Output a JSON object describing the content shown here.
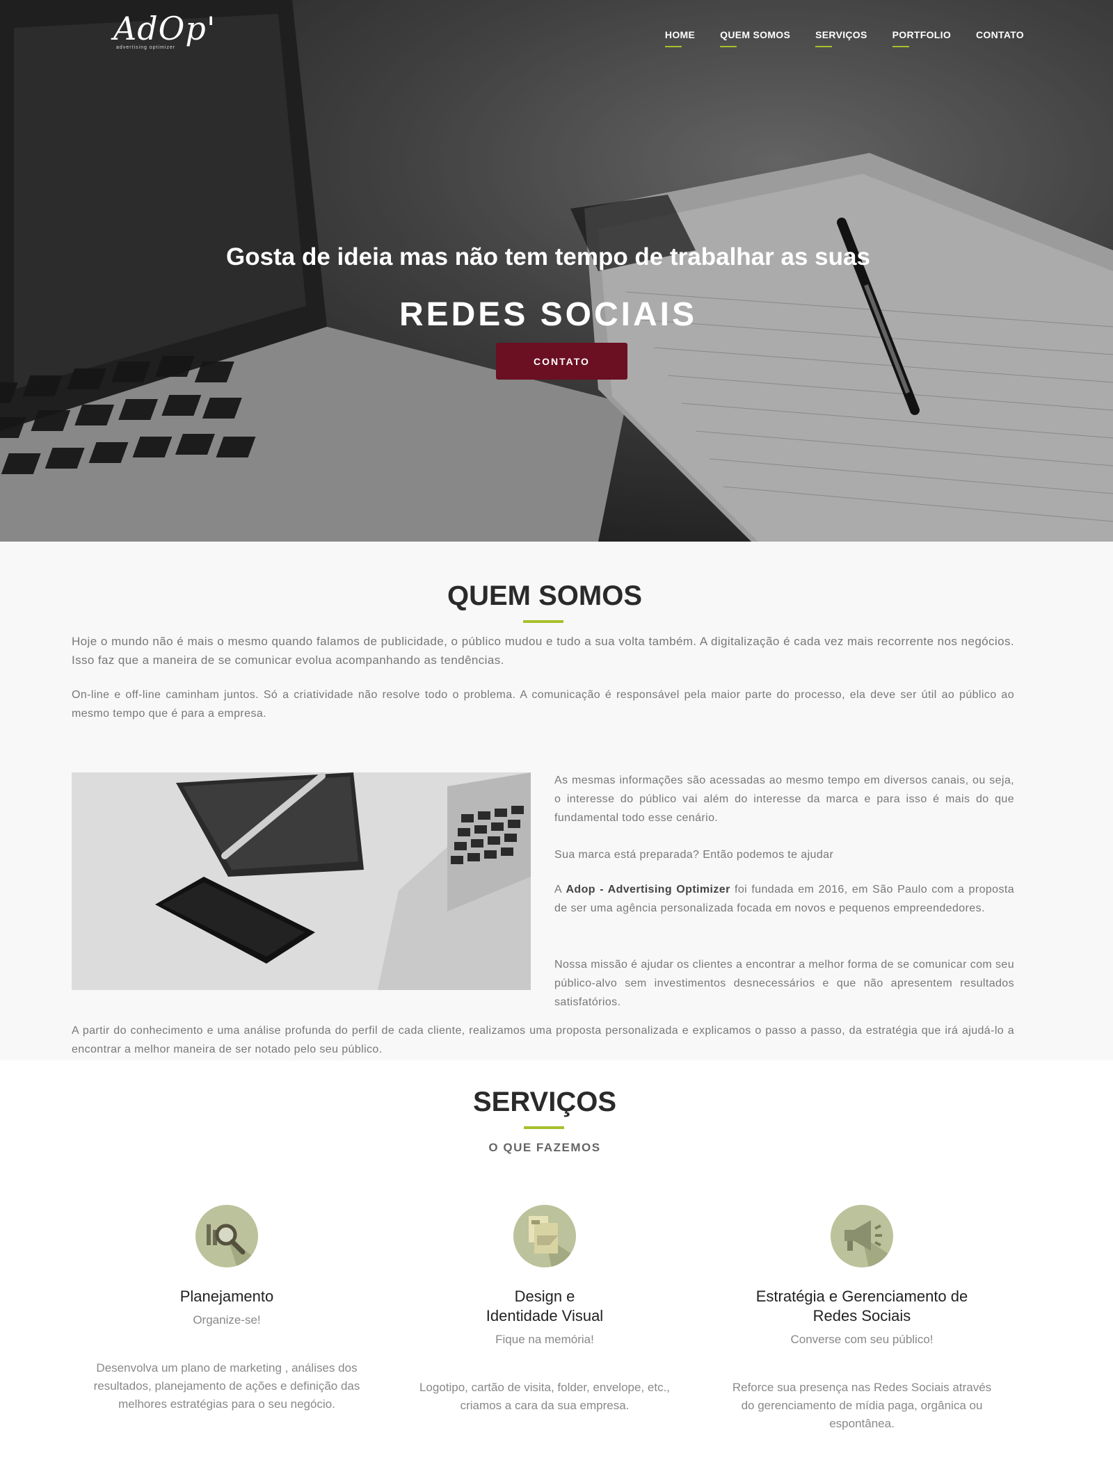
{
  "brand": {
    "logo_text": "AdOp'",
    "logo_sub": "advertising optimizer",
    "accent": "#a8c02c",
    "cta_color": "#6b0f22"
  },
  "nav": {
    "items": [
      {
        "label": "HOME",
        "underline": true
      },
      {
        "label": "QUEM SOMOS",
        "underline": true
      },
      {
        "label": "SERVIÇOS",
        "underline": true
      },
      {
        "label": "PORTFOLIO",
        "underline": true
      },
      {
        "label": "CONTATO",
        "underline": false
      }
    ]
  },
  "hero": {
    "tagline": "Gosta de ideia mas não tem tempo de trabalhar as suas",
    "headline": "REDES SOCIAIS",
    "cta": "CONTATO"
  },
  "about": {
    "title": "QUEM SOMOS",
    "p1": "Hoje o mundo não é mais o mesmo quando falamos de publicidade, o público mudou e tudo a sua volta também. A digitalização é cada vez mais recorrente nos negócios. Isso faz que a maneira de se comunicar evolua acompanhando as tendências.",
    "p2": "On-line e off-line caminham juntos. Só a criatividade não resolve todo o problema. A comunicação é responsável pela maior parte do processo, ela deve ser útil ao público ao mesmo tempo que é para a empresa.",
    "p3": "As mesmas informações são acessadas ao mesmo tempo em diversos canais, ou seja, o interesse do público vai além do interesse da marca e para isso é mais do que fundamental todo esse cenário.",
    "p4": "Sua marca está preparada? Então podemos te ajudar",
    "p5_pre": "A ",
    "p5_bold": "Adop - Advertising Optimizer",
    "p5_post": " foi fundada em 2016, em São Paulo com a proposta de ser uma agência personalizada focada em novos e pequenos empreendedores.",
    "p6": "Nossa missão é ajudar os clientes a encontrar a melhor forma de se comunicar com seu público-alvo sem investimentos desnecessários e que não apresentem resultados satisfatórios.",
    "p7": "A partir do conhecimento e uma análise profunda do perfil de cada cliente, realizamos uma proposta personalizada e explicamos o passo a passo, da estratégia que irá ajudá-lo a encontrar a melhor maneira de ser notado pelo seu público."
  },
  "services": {
    "title": "SERVIÇOS",
    "subtitle": "O QUE FAZEMOS",
    "items": [
      {
        "icon": "magnifier-chart-icon",
        "name": "Planejamento",
        "tag": "Organize-se!",
        "desc": "Desenvolva um plano de marketing , análises dos resultados, planejamento de ações e definição das melhores estratégias para o seu negócio."
      },
      {
        "icon": "documents-icon",
        "name": "Design e\nIdentidade Visual",
        "tag": "Fique na memória!",
        "desc": "Logotipo, cartão de visita, folder, envelope, etc., criamos a cara da sua empresa."
      },
      {
        "icon": "megaphone-icon",
        "name": "Estratégia e Gerenciamento de\nRedes Sociais",
        "tag": "Converse com seu público!",
        "desc": "Reforce sua presença nas Redes Sociais através do gerenciamento de mídia paga, orgânica ou espontânea."
      }
    ]
  }
}
